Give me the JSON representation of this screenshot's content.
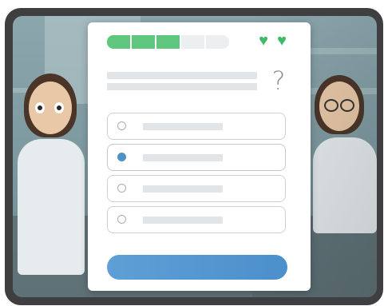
{
  "quiz": {
    "progress": {
      "total_steps": 5,
      "completed_steps": 3
    },
    "lives": {
      "count": 2,
      "icon": "heart-icon",
      "color": "#3fba66"
    },
    "question": {
      "text_lines": 2
    },
    "help": {
      "icon": "question-mark-icon",
      "glyph": "?"
    },
    "options": [
      {
        "selected": false
      },
      {
        "selected": true
      },
      {
        "selected": false
      },
      {
        "selected": false
      }
    ],
    "submit": {
      "label": ""
    }
  },
  "colors": {
    "progress_done": "#5ec77d",
    "progress_todo": "#eceeef",
    "selected_radio": "#4f92c6",
    "submit_button": "#4b8fcb"
  }
}
